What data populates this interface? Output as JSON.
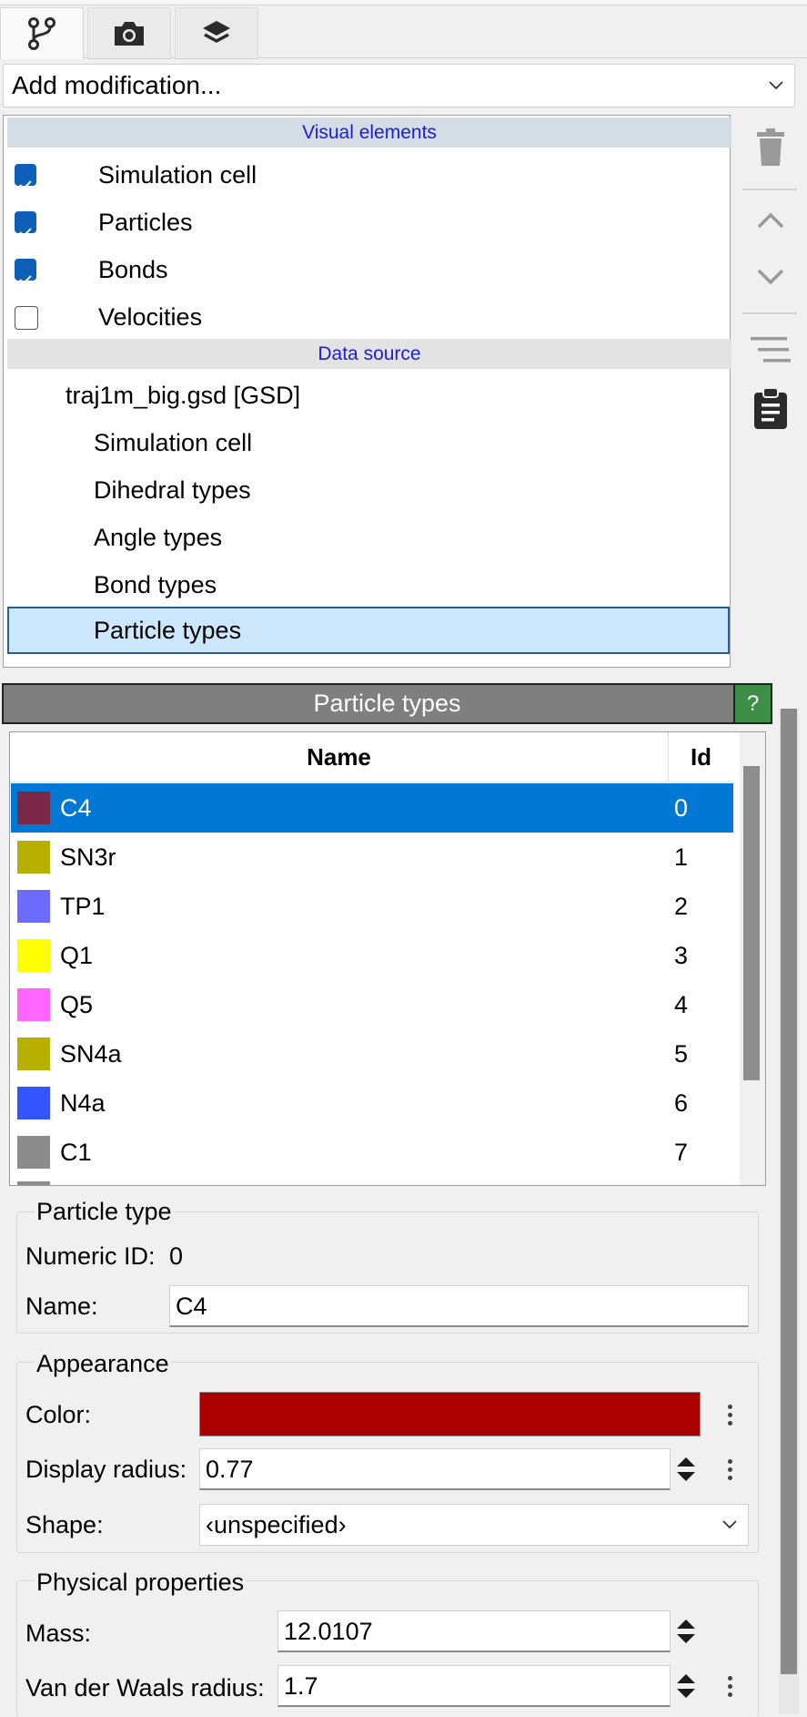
{
  "tabs": [
    {
      "icon": "pipeline-branch-icon"
    },
    {
      "icon": "camera-icon"
    },
    {
      "icon": "layers-icon"
    }
  ],
  "modification_combo": {
    "label": "Add modification..."
  },
  "pipeline": {
    "visual_header": "Visual elements",
    "visual_items": [
      {
        "label": "Simulation cell",
        "checked": true
      },
      {
        "label": "Particles",
        "checked": true
      },
      {
        "label": "Bonds",
        "checked": true
      },
      {
        "label": "Velocities",
        "checked": false
      }
    ],
    "data_header": "Data source",
    "data_source": "traj1m_big.gsd [GSD]",
    "data_items": [
      "Simulation cell",
      "Dihedral types",
      "Angle types",
      "Bond types",
      "Particle types"
    ],
    "selected_item": "Particle types"
  },
  "side_buttons": [
    "delete-icon",
    "move-up-icon",
    "move-down-icon",
    "manage-pipeline-icon",
    "clipboard-icon"
  ],
  "panel": {
    "title": "Particle types",
    "help": "?",
    "table": {
      "headers": {
        "name": "Name",
        "id": "Id"
      },
      "rows": [
        {
          "name": "C4",
          "id": "0",
          "color": "#7a2845"
        },
        {
          "name": "SN3r",
          "id": "1",
          "color": "#b8b000"
        },
        {
          "name": "TP1",
          "id": "2",
          "color": "#6b6bff"
        },
        {
          "name": "Q1",
          "id": "3",
          "color": "#ffff00"
        },
        {
          "name": "Q5",
          "id": "4",
          "color": "#ff66ff"
        },
        {
          "name": "SN4a",
          "id": "5",
          "color": "#b8b000"
        },
        {
          "name": "N4a",
          "id": "6",
          "color": "#3355ff"
        },
        {
          "name": "C1",
          "id": "7",
          "color": "#8c8c8c"
        }
      ]
    },
    "particle_type": {
      "title": "Particle type",
      "numeric_id_label": "Numeric ID:",
      "numeric_id_value": "0",
      "name_label": "Name:",
      "name_value": "C4"
    },
    "appearance": {
      "title": "Appearance",
      "color_label": "Color:",
      "color_value": "#aa0000",
      "radius_label": "Display radius:",
      "radius_value": "0.77",
      "shape_label": "Shape:",
      "shape_value": "‹unspecified›"
    },
    "physical": {
      "title": "Physical properties",
      "mass_label": "Mass:",
      "mass_value": "12.0107",
      "vdw_label": "Van der Waals radius:",
      "vdw_value": "1.7"
    }
  }
}
